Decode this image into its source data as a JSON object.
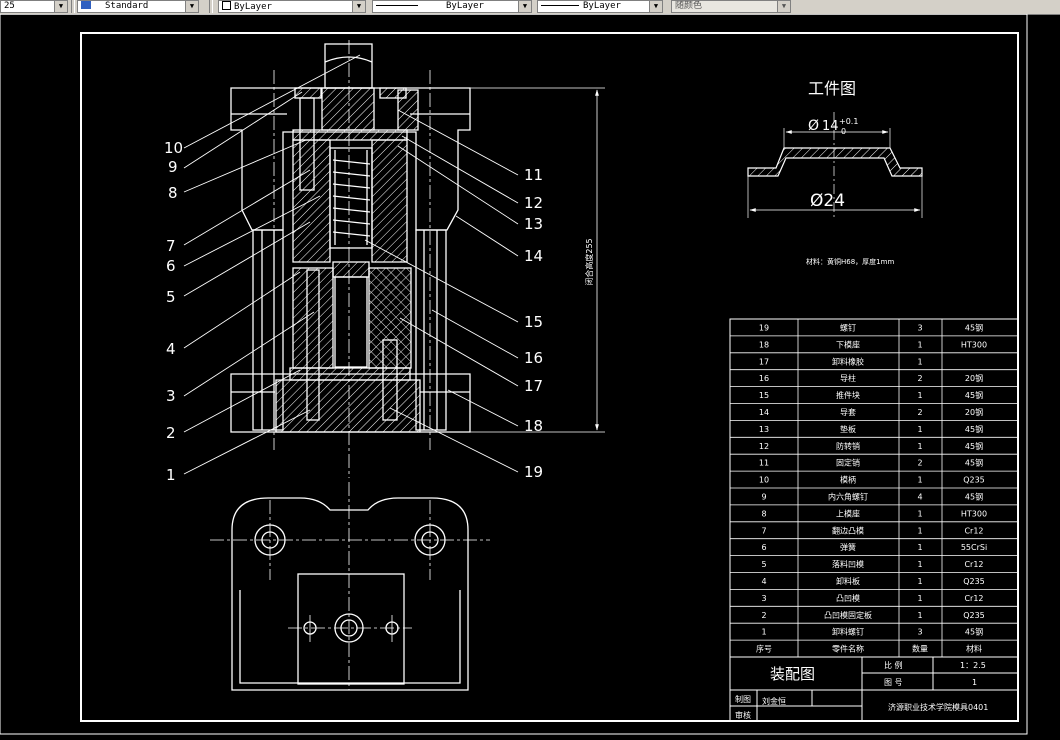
{
  "toolbar": {
    "scale_value": "25",
    "style_value": "Standard",
    "layer_value": "ByLayer",
    "linetype_value": "ByLayer",
    "lineweight_value": "ByLayer",
    "color_value": "随颜色"
  },
  "workpiece": {
    "title": "工件图",
    "dim_inner_sym": "Ø",
    "dim_inner_val": "14",
    "dim_inner_tol_upper": "+0.1",
    "dim_inner_tol_lower": "0",
    "dim_outer": "Ø24",
    "material_note": "材料：黄铜H68，厚度1mm"
  },
  "assembly": {
    "closed_height_label": "闭合高度255",
    "callouts_left": [
      "10",
      "9",
      "8",
      "7",
      "6",
      "5",
      "4",
      "3",
      "2",
      "1"
    ],
    "callouts_right": [
      "11",
      "12",
      "13",
      "14",
      "15",
      "16",
      "17",
      "18",
      "19"
    ]
  },
  "bom": {
    "rows": [
      {
        "no": "19",
        "name": "螺钉",
        "qty": "3",
        "mat": "45钢"
      },
      {
        "no": "18",
        "name": "下模座",
        "qty": "1",
        "mat": "HT300"
      },
      {
        "no": "17",
        "name": "卸料橡胶",
        "qty": "1",
        "mat": ""
      },
      {
        "no": "16",
        "name": "导柱",
        "qty": "2",
        "mat": "20钢"
      },
      {
        "no": "15",
        "name": "推件块",
        "qty": "1",
        "mat": "45钢"
      },
      {
        "no": "14",
        "name": "导套",
        "qty": "2",
        "mat": "20钢"
      },
      {
        "no": "13",
        "name": "垫板",
        "qty": "1",
        "mat": "45钢"
      },
      {
        "no": "12",
        "name": "防转销",
        "qty": "1",
        "mat": "45钢"
      },
      {
        "no": "11",
        "name": "固定销",
        "qty": "2",
        "mat": "45钢"
      },
      {
        "no": "10",
        "name": "模柄",
        "qty": "1",
        "mat": "Q235"
      },
      {
        "no": "9",
        "name": "内六角螺钉",
        "qty": "4",
        "mat": "45钢"
      },
      {
        "no": "8",
        "name": "上模座",
        "qty": "1",
        "mat": "HT300"
      },
      {
        "no": "7",
        "name": "翻边凸模",
        "qty": "1",
        "mat": "Cr12"
      },
      {
        "no": "6",
        "name": "弹簧",
        "qty": "1",
        "mat": "55CrSi"
      },
      {
        "no": "5",
        "name": "落料凹模",
        "qty": "1",
        "mat": "Cr12"
      },
      {
        "no": "4",
        "name": "卸料板",
        "qty": "1",
        "mat": "Q235"
      },
      {
        "no": "3",
        "name": "凸凹模",
        "qty": "1",
        "mat": "Cr12"
      },
      {
        "no": "2",
        "name": "凸凹模固定板",
        "qty": "1",
        "mat": "Q235"
      },
      {
        "no": "1",
        "name": "卸料螺钉",
        "qty": "3",
        "mat": "45钢"
      }
    ],
    "header": {
      "no": "序号",
      "name": "零件名称",
      "qty": "数量",
      "mat": "材料"
    }
  },
  "title_block": {
    "drawing_name": "装配图",
    "scale_label": "比  例",
    "scale_value": "1：2.5",
    "sheet_label": "图  号",
    "sheet_value": "1",
    "drawn_label": "制图",
    "drawn_value": "刘金恒",
    "review_label": "审核",
    "school": "济源职业技术学院模具0401"
  }
}
